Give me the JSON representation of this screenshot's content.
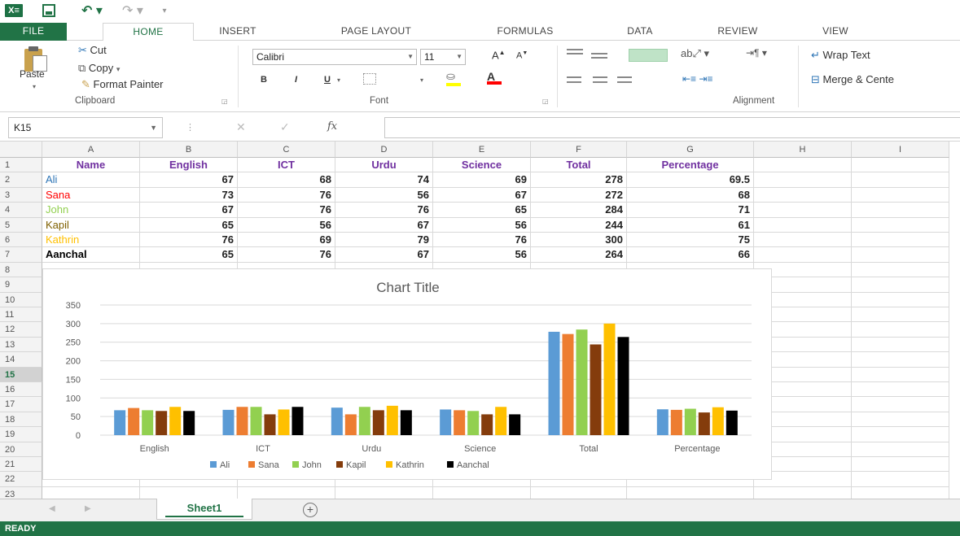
{
  "app": {
    "logo_text": "X≡",
    "undo_glyph": "↶ ▾",
    "redo_glyph": "↷ ▾",
    "customize_glyph": "▾"
  },
  "tabs": [
    "FILE",
    "HOME",
    "INSERT",
    "PAGE LAYOUT",
    "FORMULAS",
    "DATA",
    "REVIEW",
    "VIEW"
  ],
  "clipboard": {
    "paste": "Paste",
    "cut": "Cut",
    "copy": "Copy",
    "format_painter": "Format Painter",
    "group_label": "Clipboard"
  },
  "font": {
    "name": "Calibri",
    "size": "11",
    "bold": "B",
    "italic": "I",
    "underline": "U",
    "group_label": "Font"
  },
  "alignment": {
    "wrap_text": "Wrap Text",
    "merge_center": "Merge & Cente",
    "group_label": "Alignment"
  },
  "formula_bar": {
    "name_box": "K15",
    "fx": "fx",
    "value": ""
  },
  "columns": [
    "A",
    "B",
    "C",
    "D",
    "E",
    "F",
    "G",
    "H",
    "I"
  ],
  "rows": [
    "1",
    "2",
    "3",
    "4",
    "5",
    "6",
    "7",
    "8",
    "9",
    "10",
    "11",
    "12",
    "13",
    "14",
    "15",
    "16",
    "17",
    "18",
    "19",
    "20",
    "21",
    "22",
    "23"
  ],
  "active_row": "15",
  "table": {
    "headers": [
      "Name",
      "English",
      "ICT",
      "Urdu",
      "Science",
      "Total",
      "Percentage"
    ],
    "rows": [
      {
        "name": "Ali",
        "color": "#2e75b6",
        "values": [
          "67",
          "68",
          "74",
          "69",
          "278",
          "69.5"
        ]
      },
      {
        "name": "Sana",
        "color": "#ff0000",
        "values": [
          "73",
          "76",
          "56",
          "67",
          "272",
          "68"
        ]
      },
      {
        "name": "John",
        "color": "#92d050",
        "values": [
          "67",
          "76",
          "76",
          "65",
          "284",
          "71"
        ]
      },
      {
        "name": "Kapil",
        "color": "#7f6000",
        "values": [
          "65",
          "56",
          "67",
          "56",
          "244",
          "61"
        ]
      },
      {
        "name": "Kathrin",
        "color": "#ffc000",
        "values": [
          "76",
          "69",
          "79",
          "76",
          "300",
          "75"
        ]
      },
      {
        "name": "Aanchal",
        "color": "#000000",
        "values": [
          "65",
          "76",
          "67",
          "56",
          "264",
          "66"
        ]
      }
    ]
  },
  "chart_data": {
    "type": "bar",
    "title": "Chart Title",
    "categories": [
      "English",
      "ICT",
      "Urdu",
      "Science",
      "Total",
      "Percentage"
    ],
    "ylim": [
      0,
      350
    ],
    "yticks": [
      "0",
      "50",
      "100",
      "150",
      "200",
      "250",
      "300",
      "350"
    ],
    "grid": true,
    "legend_position": "bottom",
    "series": [
      {
        "name": "Ali",
        "color": "#5b9bd5",
        "values": [
          67,
          68,
          74,
          69,
          278,
          69.5
        ]
      },
      {
        "name": "Sana",
        "color": "#ed7d31",
        "values": [
          73,
          76,
          56,
          67,
          272,
          68
        ]
      },
      {
        "name": "John",
        "color": "#92d050",
        "values": [
          67,
          76,
          76,
          65,
          284,
          71
        ]
      },
      {
        "name": "Kapil",
        "color": "#843c0c",
        "values": [
          65,
          56,
          67,
          56,
          244,
          61
        ]
      },
      {
        "name": "Kathrin",
        "color": "#ffc000",
        "values": [
          76,
          69,
          79,
          76,
          300,
          75
        ]
      },
      {
        "name": "Aanchal",
        "color": "#000000",
        "values": [
          65,
          76,
          67,
          56,
          264,
          66
        ]
      }
    ]
  },
  "sheets": [
    "Sheet1"
  ],
  "status": "READY",
  "colors": {
    "excel_green": "#217346",
    "header_purple": "#7030a0"
  }
}
